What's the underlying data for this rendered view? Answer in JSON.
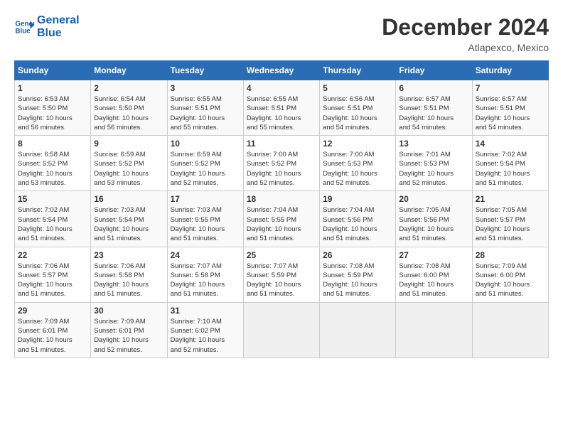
{
  "logo": {
    "line1": "General",
    "line2": "Blue"
  },
  "title": "December 2024",
  "subtitle": "Atlapexco, Mexico",
  "days_header": [
    "Sunday",
    "Monday",
    "Tuesday",
    "Wednesday",
    "Thursday",
    "Friday",
    "Saturday"
  ],
  "weeks": [
    [
      {
        "day": "1",
        "info": "Sunrise: 6:53 AM\nSunset: 5:50 PM\nDaylight: 10 hours\nand 56 minutes."
      },
      {
        "day": "2",
        "info": "Sunrise: 6:54 AM\nSunset: 5:50 PM\nDaylight: 10 hours\nand 56 minutes."
      },
      {
        "day": "3",
        "info": "Sunrise: 6:55 AM\nSunset: 5:51 PM\nDaylight: 10 hours\nand 55 minutes."
      },
      {
        "day": "4",
        "info": "Sunrise: 6:55 AM\nSunset: 5:51 PM\nDaylight: 10 hours\nand 55 minutes."
      },
      {
        "day": "5",
        "info": "Sunrise: 6:56 AM\nSunset: 5:51 PM\nDaylight: 10 hours\nand 54 minutes."
      },
      {
        "day": "6",
        "info": "Sunrise: 6:57 AM\nSunset: 5:51 PM\nDaylight: 10 hours\nand 54 minutes."
      },
      {
        "day": "7",
        "info": "Sunrise: 6:57 AM\nSunset: 5:51 PM\nDaylight: 10 hours\nand 54 minutes."
      }
    ],
    [
      {
        "day": "8",
        "info": "Sunrise: 6:58 AM\nSunset: 5:52 PM\nDaylight: 10 hours\nand 53 minutes."
      },
      {
        "day": "9",
        "info": "Sunrise: 6:59 AM\nSunset: 5:52 PM\nDaylight: 10 hours\nand 53 minutes."
      },
      {
        "day": "10",
        "info": "Sunrise: 6:59 AM\nSunset: 5:52 PM\nDaylight: 10 hours\nand 52 minutes."
      },
      {
        "day": "11",
        "info": "Sunrise: 7:00 AM\nSunset: 5:52 PM\nDaylight: 10 hours\nand 52 minutes."
      },
      {
        "day": "12",
        "info": "Sunrise: 7:00 AM\nSunset: 5:53 PM\nDaylight: 10 hours\nand 52 minutes."
      },
      {
        "day": "13",
        "info": "Sunrise: 7:01 AM\nSunset: 5:53 PM\nDaylight: 10 hours\nand 52 minutes."
      },
      {
        "day": "14",
        "info": "Sunrise: 7:02 AM\nSunset: 5:54 PM\nDaylight: 10 hours\nand 51 minutes."
      }
    ],
    [
      {
        "day": "15",
        "info": "Sunrise: 7:02 AM\nSunset: 5:54 PM\nDaylight: 10 hours\nand 51 minutes."
      },
      {
        "day": "16",
        "info": "Sunrise: 7:03 AM\nSunset: 5:54 PM\nDaylight: 10 hours\nand 51 minutes."
      },
      {
        "day": "17",
        "info": "Sunrise: 7:03 AM\nSunset: 5:55 PM\nDaylight: 10 hours\nand 51 minutes."
      },
      {
        "day": "18",
        "info": "Sunrise: 7:04 AM\nSunset: 5:55 PM\nDaylight: 10 hours\nand 51 minutes."
      },
      {
        "day": "19",
        "info": "Sunrise: 7:04 AM\nSunset: 5:56 PM\nDaylight: 10 hours\nand 51 minutes."
      },
      {
        "day": "20",
        "info": "Sunrise: 7:05 AM\nSunset: 5:56 PM\nDaylight: 10 hours\nand 51 minutes."
      },
      {
        "day": "21",
        "info": "Sunrise: 7:05 AM\nSunset: 5:57 PM\nDaylight: 10 hours\nand 51 minutes."
      }
    ],
    [
      {
        "day": "22",
        "info": "Sunrise: 7:06 AM\nSunset: 5:57 PM\nDaylight: 10 hours\nand 51 minutes."
      },
      {
        "day": "23",
        "info": "Sunrise: 7:06 AM\nSunset: 5:58 PM\nDaylight: 10 hours\nand 51 minutes."
      },
      {
        "day": "24",
        "info": "Sunrise: 7:07 AM\nSunset: 5:58 PM\nDaylight: 10 hours\nand 51 minutes."
      },
      {
        "day": "25",
        "info": "Sunrise: 7:07 AM\nSunset: 5:59 PM\nDaylight: 10 hours\nand 51 minutes."
      },
      {
        "day": "26",
        "info": "Sunrise: 7:08 AM\nSunset: 5:59 PM\nDaylight: 10 hours\nand 51 minutes."
      },
      {
        "day": "27",
        "info": "Sunrise: 7:08 AM\nSunset: 6:00 PM\nDaylight: 10 hours\nand 51 minutes."
      },
      {
        "day": "28",
        "info": "Sunrise: 7:09 AM\nSunset: 6:00 PM\nDaylight: 10 hours\nand 51 minutes."
      }
    ],
    [
      {
        "day": "29",
        "info": "Sunrise: 7:09 AM\nSunset: 6:01 PM\nDaylight: 10 hours\nand 51 minutes."
      },
      {
        "day": "30",
        "info": "Sunrise: 7:09 AM\nSunset: 6:01 PM\nDaylight: 10 hours\nand 52 minutes."
      },
      {
        "day": "31",
        "info": "Sunrise: 7:10 AM\nSunset: 6:02 PM\nDaylight: 10 hours\nand 52 minutes."
      },
      {
        "day": "",
        "info": ""
      },
      {
        "day": "",
        "info": ""
      },
      {
        "day": "",
        "info": ""
      },
      {
        "day": "",
        "info": ""
      }
    ]
  ]
}
